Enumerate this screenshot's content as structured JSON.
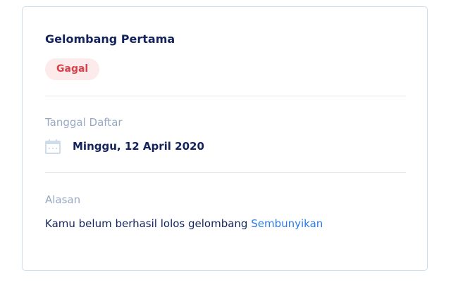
{
  "card": {
    "title": "Gelombang Pertama",
    "status_badge": "Gagal",
    "registration": {
      "label": "Tanggal Daftar",
      "icon": "calendar-icon",
      "value": "Minggu, 12 April 2020"
    },
    "reason": {
      "label": "Alasan",
      "text": "Kamu belum berhasil lolos gelombang",
      "hide_link": "Sembunyikan"
    }
  },
  "colors": {
    "title": "#13235b",
    "badge_bg": "#fdeaea",
    "badge_text": "#d8404a",
    "label": "#98a9c3",
    "link": "#2a7be8",
    "border": "#cfdcea"
  }
}
